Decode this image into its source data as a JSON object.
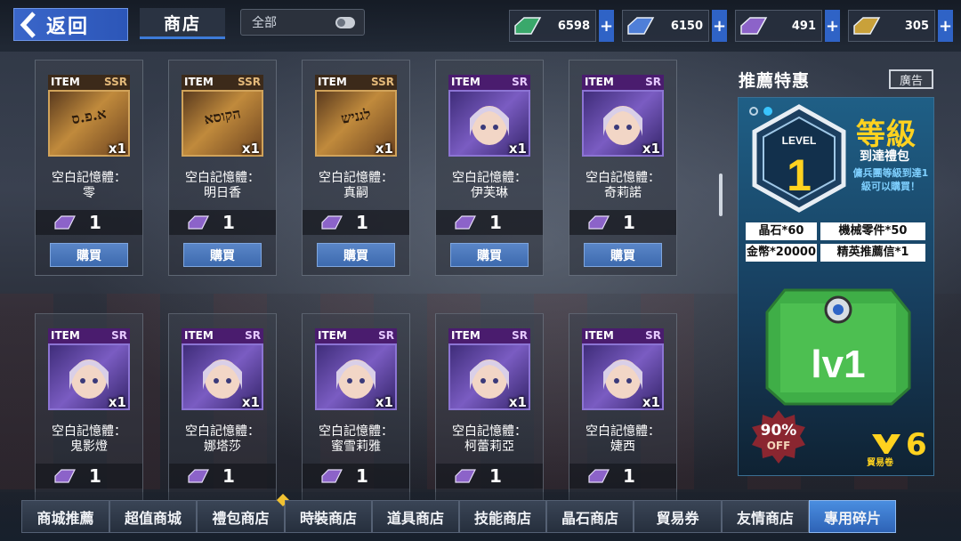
{
  "header": {
    "back_label": "返回",
    "shop_tab_label": "商店",
    "filter_label": "全部"
  },
  "currencies": [
    {
      "value": "6598",
      "color": "#3aa86b",
      "icon": "green-gem-icon"
    },
    {
      "value": "6150",
      "color": "#4f7fd8",
      "icon": "blue-gem-icon"
    },
    {
      "value": "491",
      "color": "#8c63c9",
      "icon": "purple-gem-icon"
    },
    {
      "value": "305",
      "color": "#c9a13a",
      "icon": "gold-gem-icon"
    }
  ],
  "plus_label": "+",
  "items": [
    {
      "type": "ITEM",
      "rarity": "SSR",
      "qty": "x1",
      "name_line1": "空白記憶體：",
      "name_line2": "零",
      "price": "1",
      "buy": "購買",
      "glyph": "א.פ.ס"
    },
    {
      "type": "ITEM",
      "rarity": "SSR",
      "qty": "x1",
      "name_line1": "空白記憶體：",
      "name_line2": "明日香",
      "price": "1",
      "buy": "購買",
      "glyph": "הקוסא"
    },
    {
      "type": "ITEM",
      "rarity": "SSR",
      "qty": "x1",
      "name_line1": "空白記憶體：",
      "name_line2": "真嗣",
      "price": "1",
      "buy": "購買",
      "glyph": "לגניש"
    },
    {
      "type": "ITEM",
      "rarity": "SR",
      "qty": "x1",
      "name_line1": "空白記憶體：",
      "name_line2": "伊芙琳",
      "price": "1",
      "buy": "購買"
    },
    {
      "type": "ITEM",
      "rarity": "SR",
      "qty": "x1",
      "name_line1": "空白記憶體：",
      "name_line2": "奇莉諾",
      "price": "1",
      "buy": "購買"
    },
    {
      "type": "ITEM",
      "rarity": "SR",
      "qty": "x1",
      "name_line1": "空白記憶體：",
      "name_line2": "鬼影燈",
      "price": "1"
    },
    {
      "type": "ITEM",
      "rarity": "SR",
      "qty": "x1",
      "name_line1": "空白記憶體：",
      "name_line2": "娜塔莎",
      "price": "1"
    },
    {
      "type": "ITEM",
      "rarity": "SR",
      "qty": "x1",
      "name_line1": "空白記憶體：",
      "name_line2": "蜜雪莉雅",
      "price": "1"
    },
    {
      "type": "ITEM",
      "rarity": "SR",
      "qty": "x1",
      "name_line1": "空白記憶體：",
      "name_line2": "柯蕾莉亞",
      "price": "1"
    },
    {
      "type": "ITEM",
      "rarity": "SR",
      "qty": "x1",
      "name_line1": "空白記憶體：",
      "name_line2": "婕西",
      "price": "1"
    }
  ],
  "promo": {
    "title": "推薦特惠",
    "ad_label": "廣告",
    "level_word": "LEVEL",
    "level_num": "1",
    "headline": "等級",
    "subhead": "到達禮包",
    "desc": "傭兵團等級到達1級可以購買！",
    "rewards": [
      "晶石*60",
      "機械零件*50",
      "金幣*20000",
      "精英推薦信*1"
    ],
    "crate_label": "lv1",
    "discount_pct": "90%",
    "discount_off": "OFF",
    "trade_num": "6",
    "trade_label": "貿易卷"
  },
  "bottom_tabs": [
    {
      "label": "商城推薦",
      "active": false
    },
    {
      "label": "超值商城",
      "active": false
    },
    {
      "label": "禮包商店",
      "active": false,
      "badge": true
    },
    {
      "label": "時裝商店",
      "active": false
    },
    {
      "label": "道具商店",
      "active": false
    },
    {
      "label": "技能商店",
      "active": false
    },
    {
      "label": "晶石商店",
      "active": false
    },
    {
      "label": "貿易券",
      "active": false
    },
    {
      "label": "友情商店",
      "active": false
    },
    {
      "label": "專用碎片",
      "active": true
    }
  ]
}
